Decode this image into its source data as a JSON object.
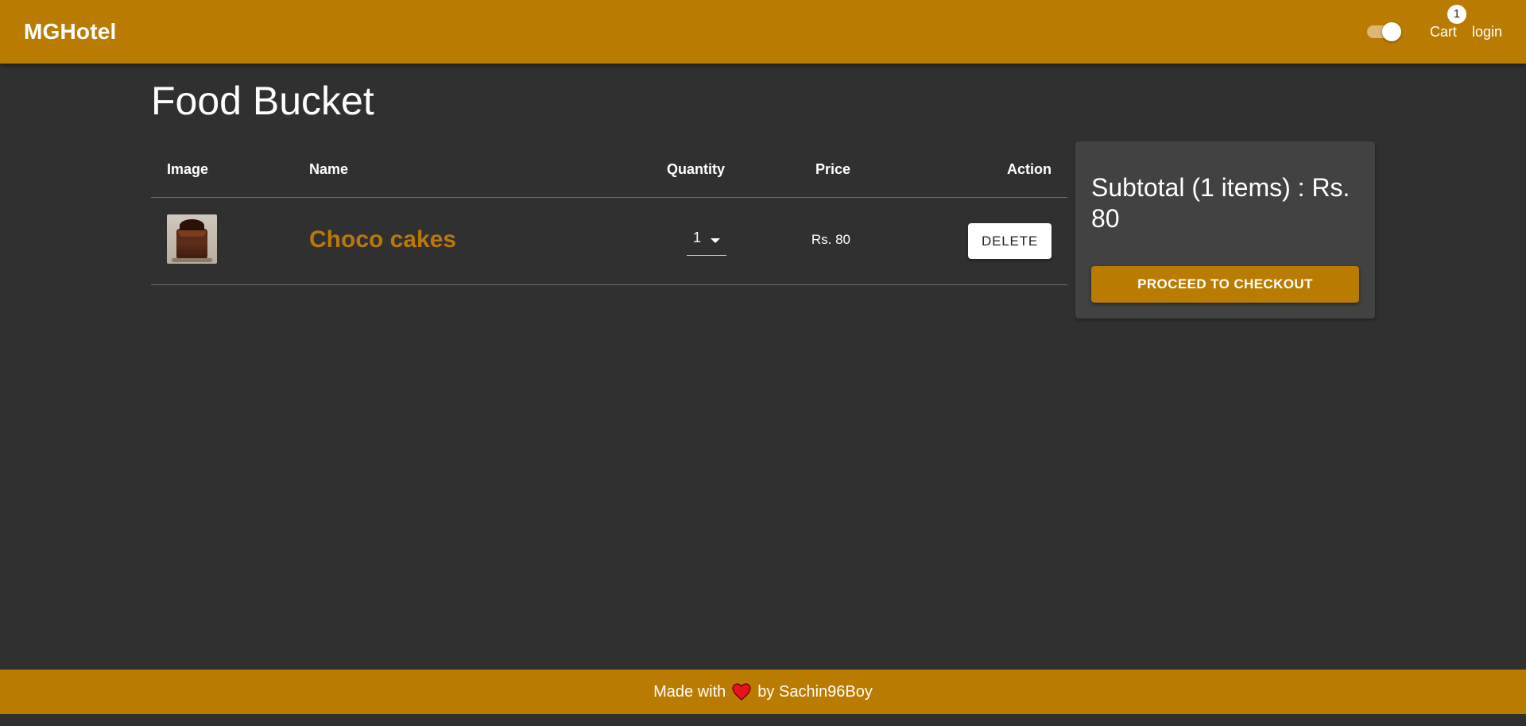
{
  "header": {
    "brand": "MGHotel",
    "cart_label": "Cart",
    "cart_count": "1",
    "login_label": "login",
    "theme_toggle": "on",
    "accent_color": "#ba7c00"
  },
  "page": {
    "title": "Food Bucket"
  },
  "table": {
    "headers": {
      "image": "Image",
      "name": "Name",
      "quantity": "Quantity",
      "price": "Price",
      "action": "Action"
    },
    "rows": [
      {
        "image_icon": "chocolate-cake-image",
        "name": "Choco cakes",
        "quantity": "1",
        "price": "Rs. 80",
        "action_label": "DELETE"
      }
    ]
  },
  "summary": {
    "subtotal": "Subtotal (1 items) : Rs. 80",
    "checkout_label": "PROCEED TO CHECKOUT"
  },
  "footer": {
    "made_with": "Made with",
    "heart_icon": "heart-icon",
    "by_text": "by Sachin96Boy",
    "heart_color": "#e3141c"
  }
}
